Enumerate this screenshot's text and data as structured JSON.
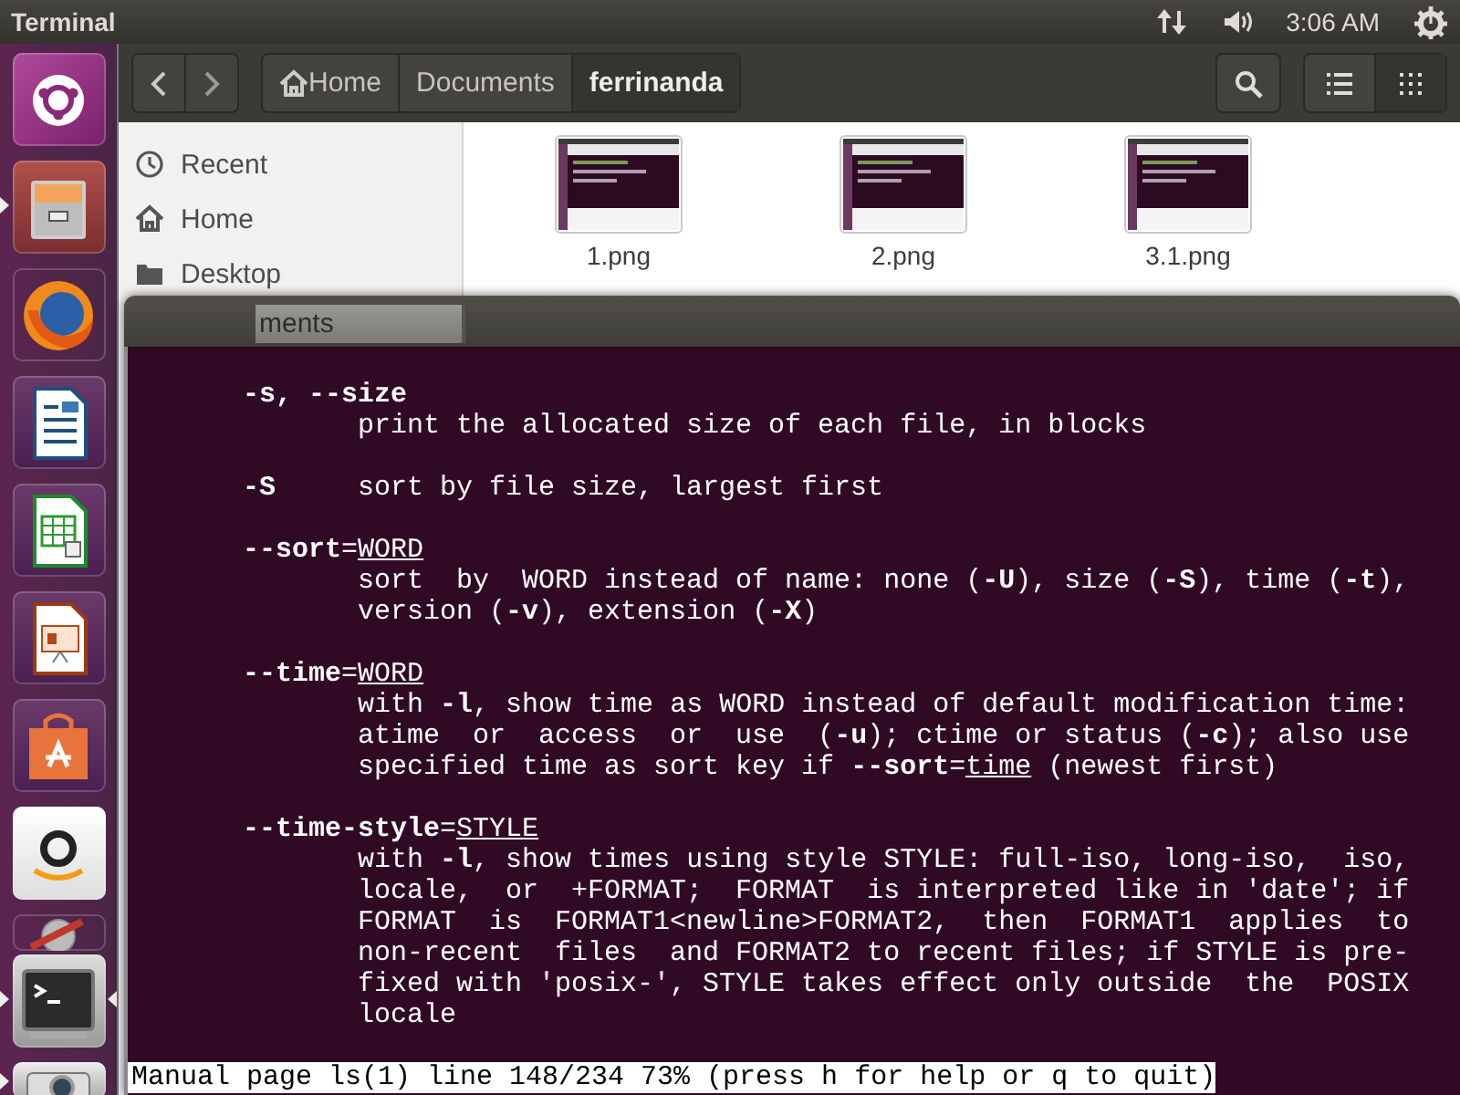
{
  "top_panel": {
    "title": "Terminal",
    "clock": "3:06 AM"
  },
  "launcher": [
    {
      "kind": "ubuntu",
      "running": false,
      "focused": false,
      "folded": false
    },
    {
      "kind": "files",
      "running": true,
      "focused": false,
      "folded": false
    },
    {
      "kind": "firefox",
      "running": false,
      "focused": false,
      "folded": false
    },
    {
      "kind": "writer",
      "running": false,
      "focused": false,
      "folded": false
    },
    {
      "kind": "calc",
      "running": false,
      "focused": false,
      "folded": false
    },
    {
      "kind": "impress",
      "running": false,
      "focused": false,
      "folded": false
    },
    {
      "kind": "software",
      "running": false,
      "focused": false,
      "folded": false
    },
    {
      "kind": "amazon",
      "running": false,
      "focused": false,
      "folded": false
    },
    {
      "kind": "settings",
      "running": false,
      "focused": false,
      "folded": true
    },
    {
      "kind": "terminal",
      "running": true,
      "focused": true,
      "folded": false
    },
    {
      "kind": "camera",
      "running": true,
      "focused": false,
      "folded": true
    }
  ],
  "file_manager": {
    "breadcrumb": [
      {
        "label": "Home",
        "kind": "home",
        "selected": false
      },
      {
        "label": "Documents",
        "kind": "folder",
        "selected": false
      },
      {
        "label": "ferrinanda",
        "kind": "folder",
        "selected": true
      }
    ],
    "view_modes": [
      {
        "kind": "list",
        "selected": false
      },
      {
        "kind": "grid",
        "selected": true
      }
    ],
    "sidebar": [
      {
        "label": "Recent",
        "kind": "recent"
      },
      {
        "label": "Home",
        "kind": "home"
      },
      {
        "label": "Desktop",
        "kind": "folder"
      }
    ],
    "files": [
      {
        "name": "1.png",
        "kind": "picture"
      },
      {
        "name": "2.png",
        "kind": "picture"
      },
      {
        "name": "3.1.png",
        "kind": "picture"
      }
    ]
  },
  "terminal": {
    "dragged_tab": "ments",
    "entries": [
      {
        "lines": [
          {
            "kind": "option",
            "option": "-s, --size"
          },
          {
            "kind": "text",
            "text": "print the allocated size of each file, in blocks"
          }
        ]
      },
      {
        "lines": [
          {
            "kind": "option",
            "option": "-S",
            "description": "sort by file size, largest first"
          }
        ]
      },
      {
        "lines": [
          {
            "kind": "option",
            "option": "--sort",
            "separator": "=",
            "argument": "WORD"
          },
          {
            "kind": "text",
            "text": "sort  by  WORD instead of name: none (**-U**), size (**-S**), time (**-t**),"
          },
          {
            "kind": "text",
            "text": "version (**-v**), extension (**-X**)"
          }
        ]
      },
      {
        "lines": [
          {
            "kind": "option",
            "option": "--time",
            "separator": "=",
            "argument": "WORD"
          },
          {
            "kind": "text",
            "text": "with **-l**, show time as WORD instead of default modification time:"
          },
          {
            "kind": "text",
            "text": "atime  or  access  or  use  (**-u**); ctime or status (**-c**); also use"
          },
          {
            "kind": "text",
            "text": "specified time as sort key if **--sort**=",
            "argument": "time",
            "rest": " (newest first)"
          }
        ]
      },
      {
        "lines": [
          {
            "kind": "option",
            "option": "--time-style",
            "separator": "=",
            "argument": "STYLE"
          },
          {
            "kind": "text",
            "text": "with **-l**, show times using style STYLE: full-iso, long-iso,  iso,"
          },
          {
            "kind": "text",
            "text": "locale,  or  +FORMAT;  FORMAT  is interpreted like in 'date'; if"
          },
          {
            "kind": "text",
            "text": "FORMAT  is  FORMAT1<newline>FORMAT2,  then  FORMAT1  applies  to"
          },
          {
            "kind": "text",
            "text": "non-recent  files  and FORMAT2 to recent files; if STYLE is pre-"
          },
          {
            "kind": "text",
            "text": "fixed with 'posix-', STYLE takes effect only outside  the  POSIX"
          },
          {
            "kind": "text",
            "text": "locale"
          }
        ]
      }
    ],
    "status": "Manual page ls(1) line 148/234 73% (press h for help or q to quit)"
  }
}
